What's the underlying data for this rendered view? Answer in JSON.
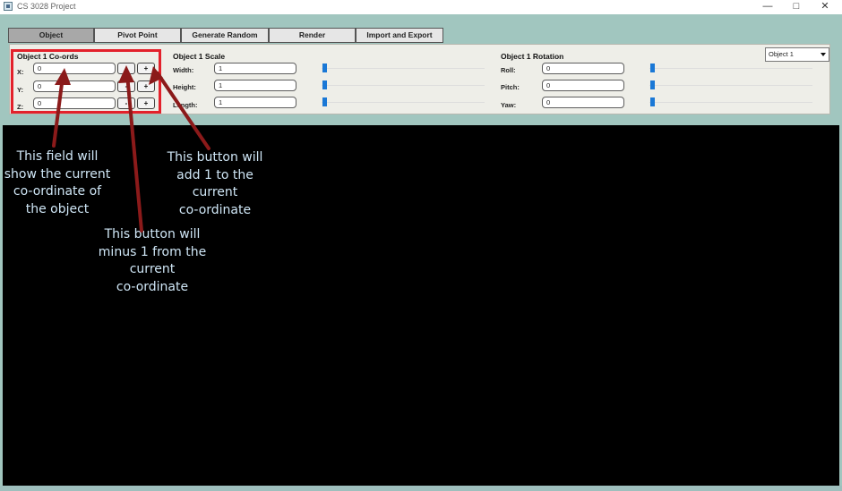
{
  "window": {
    "title": "CS 3028 Project",
    "min_icon": "minimize-icon",
    "max_icon": "maximize-icon",
    "close_icon": "close-icon"
  },
  "tabs": [
    {
      "label": "Object",
      "active": true
    },
    {
      "label": "Pivot Point",
      "active": false
    },
    {
      "label": "Generate Random",
      "active": false
    },
    {
      "label": "Render",
      "active": false
    },
    {
      "label": "Import and Export",
      "active": false
    }
  ],
  "coords": {
    "title": "Object 1 Co-ords",
    "rows": [
      {
        "label": "X:",
        "value": "0",
        "minus": "-",
        "plus": "+"
      },
      {
        "label": "Y:",
        "value": "0",
        "minus": "-",
        "plus": "+"
      },
      {
        "label": "Z:",
        "value": "0",
        "minus": "-",
        "plus": "+"
      }
    ]
  },
  "scale": {
    "title": "Object 1 Scale",
    "rows": [
      {
        "label": "Width:",
        "value": "1",
        "slider": 0.0
      },
      {
        "label": "Height:",
        "value": "1",
        "slider": 0.0
      },
      {
        "label": "Length:",
        "value": "1",
        "slider": 0.0
      }
    ]
  },
  "rotation": {
    "title": "Object 1 Rotation",
    "rows": [
      {
        "label": "Roll:",
        "value": "0",
        "slider": 0.0
      },
      {
        "label": "Pitch:",
        "value": "0",
        "slider": 0.0
      },
      {
        "label": "Yaw:",
        "value": "0",
        "slider": 0.0
      }
    ]
  },
  "object_select": {
    "value": "Object 1"
  },
  "annotations": {
    "field": [
      "This field will",
      "show the current",
      "co-ordinate of",
      "the object"
    ],
    "minus": [
      "This button will",
      "minus 1 from the",
      "current",
      "co-ordinate"
    ],
    "plus": [
      "This button will",
      "add 1 to the",
      "current",
      "co-ordinate"
    ]
  },
  "colors": {
    "highlight": "#e3212b",
    "arrow": "#8b1a1a",
    "annotation_text": "#cfe6f6",
    "slider_thumb": "#1a78d6",
    "background": "#a1c6bf"
  }
}
